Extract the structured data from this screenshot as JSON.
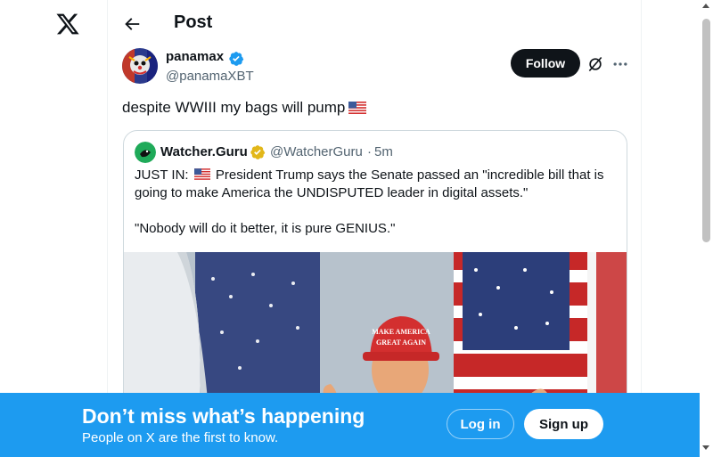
{
  "app": {
    "logo_icon": "x-logo-icon"
  },
  "header": {
    "title": "Post",
    "back_icon": "arrow-left-icon"
  },
  "post": {
    "author_name": "panamax",
    "author_handle": "@panamaXBT",
    "verified_icon": "blue-verified-badge-icon",
    "follow_label": "Follow",
    "text": "despite WWIII my bags will pump",
    "flag_icon": "us-flag-emoji"
  },
  "quote": {
    "author_name": "Watcher.Guru",
    "author_handle": "@WatcherGuru",
    "separator": "·",
    "time": "5m",
    "verified_icon": "gold-verified-badge-icon",
    "text_prefix": "JUST IN:",
    "text_body": "President Trump says the Senate passed an \"incredible bill that is going to make America the UNDISPUTED leader in digital assets.\"",
    "text_line2": "\"Nobody will do it better, it is pure GENIUS.\"",
    "photo_hat_text_1": "MAKE AMERICA",
    "photo_hat_text_2": "GREAT AGAIN"
  },
  "banner": {
    "title": "Don’t miss what’s happening",
    "subtitle": "People on X are the first to know.",
    "login_label": "Log in",
    "signup_label": "Sign up"
  },
  "colors": {
    "brand_blue": "#1d9bf0",
    "text_primary": "#0f1419",
    "text_secondary": "#536471",
    "border": "#cfd9de"
  }
}
